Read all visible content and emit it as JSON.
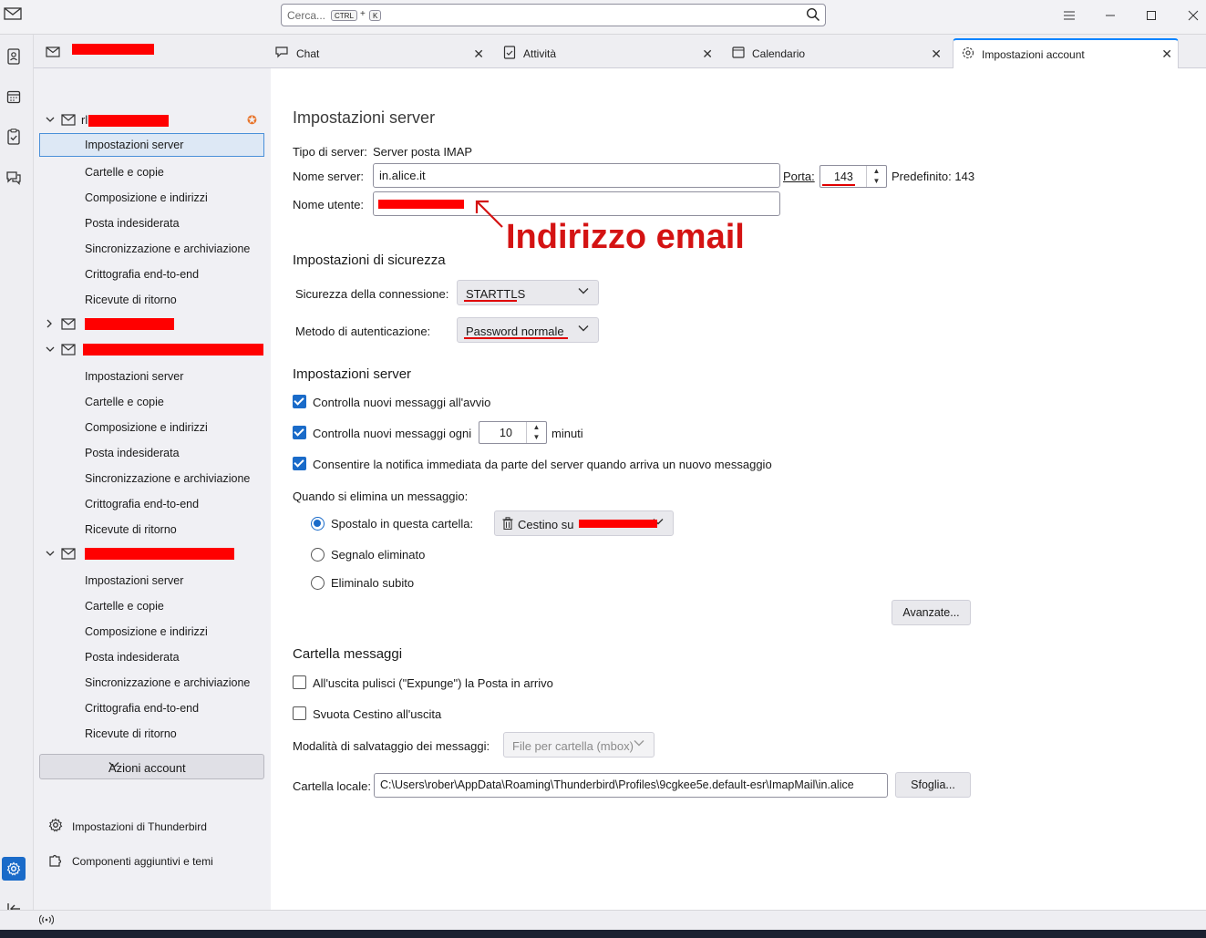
{
  "search": {
    "placeholder": "Cerca...",
    "kbd1": "CTRL",
    "plus": "+",
    "kbd2": "K"
  },
  "tabs": [
    {
      "label": ""
    },
    {
      "label": "Chat"
    },
    {
      "label": "Attività"
    },
    {
      "label": "Calendario"
    },
    {
      "label": "Impostazioni account"
    }
  ],
  "accounts": [
    {
      "name": "rl",
      "items": [
        "Impostazioni server",
        "Cartelle e copie",
        "Composizione e indirizzi",
        "Posta indesiderata",
        "Sincronizzazione e archiviazione",
        "Crittografia end-to-end",
        "Ricevute di ritorno"
      ]
    },
    {
      "name": "",
      "items": []
    },
    {
      "name": "",
      "items": [
        "Impostazioni server",
        "Cartelle e copie",
        "Composizione e indirizzi",
        "Posta indesiderata",
        "Sincronizzazione e archiviazione",
        "Crittografia end-to-end",
        "Ricevute di ritorno"
      ]
    },
    {
      "name": "",
      "items": [
        "Impostazioni server",
        "Cartelle e copie",
        "Composizione e indirizzi",
        "Posta indesiderata",
        "Sincronizzazione e archiviazione",
        "Crittografia end-to-end",
        "Ricevute di ritorno"
      ]
    }
  ],
  "account_actions": "Azioni account",
  "bottom_links": {
    "settings": "Impostazioni di Thunderbird",
    "addons": "Componenti aggiuntivi e temi"
  },
  "main": {
    "title": "Impostazioni server",
    "server_type_label": "Tipo di server:",
    "server_type_value": "Server posta IMAP",
    "server_name_label": "Nome server:",
    "server_name_value": "in.alice.it",
    "port_label": "Porta:",
    "port_value": "143",
    "default_label": "Predefinito: 143",
    "username_label": "Nome utente:",
    "annotation": "Indirizzo email",
    "security_heading": "Impostazioni di sicurezza",
    "conn_security_label": "Sicurezza della connessione:",
    "conn_security_value": "STARTTLS",
    "auth_label": "Metodo di autenticazione:",
    "auth_value": "Password normale",
    "server_heading": "Impostazioni server",
    "check_startup": "Controlla nuovi messaggi all'avvio",
    "check_every": "Controlla nuovi messaggi ogni",
    "check_every_value": "10",
    "minutes": "minuti",
    "allow_notify": "Consentire la notifica immediata da parte del server quando arriva un nuovo messaggio",
    "delete_label": "Quando si elimina un messaggio:",
    "move_to_folder": "Spostalo in questa cartella:",
    "trash_select": "Cestino su",
    "mark_deleted": "Segnalo eliminato",
    "delete_now": "Eliminalo subito",
    "advanced_button": "Avanzate...",
    "folder_heading": "Cartella messaggi",
    "expunge_on_exit": "All'uscita pulisci (\"Expunge\") la Posta in arrivo",
    "empty_trash": "Svuota Cestino all'uscita",
    "storage_label": "Modalità di salvataggio dei messaggi:",
    "storage_value": "File per cartella (mbox)",
    "local_folder_label": "Cartella locale:",
    "local_folder_value": "C:\\Users\\rober\\AppData\\Roaming\\Thunderbird\\Profiles\\9cgkee5e.default-esr\\ImapMail\\in.alice",
    "browse_button": "Sfoglia..."
  },
  "colors": {
    "accent": "#1a6bc9",
    "annotation": "#d41313",
    "redaction": "#ff0000"
  }
}
